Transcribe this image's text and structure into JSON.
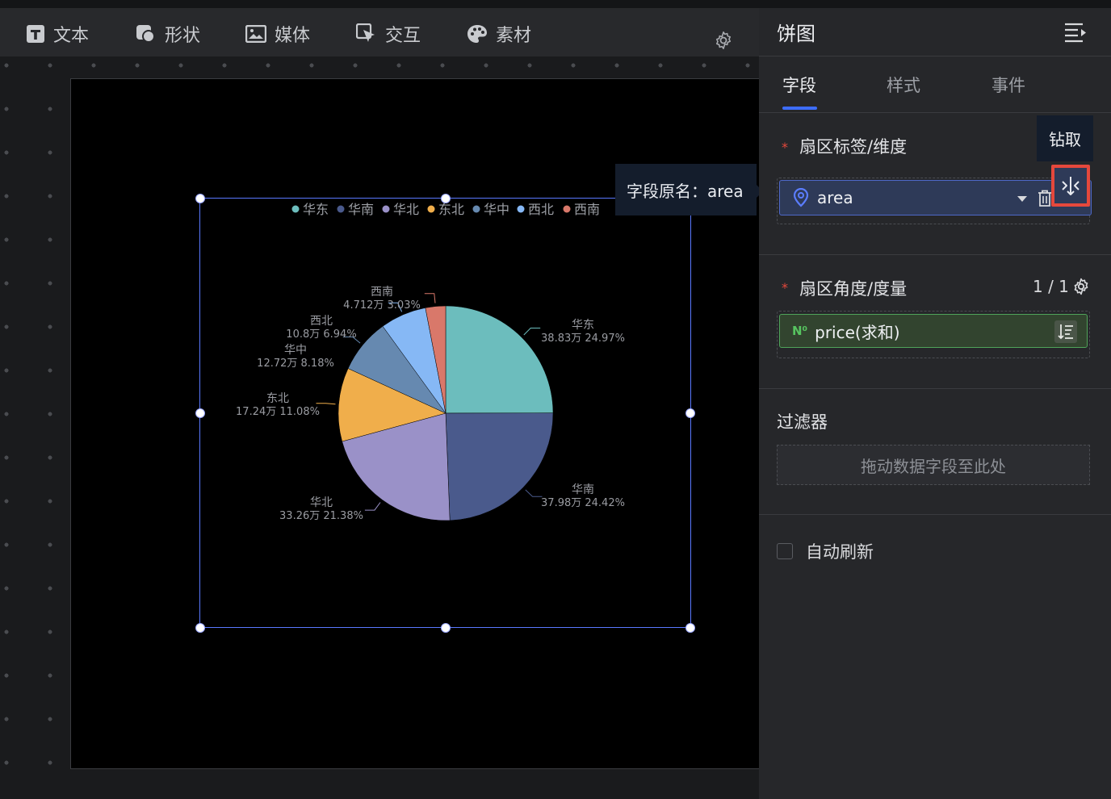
{
  "toolbar": {
    "items": [
      {
        "label": "文本",
        "icon": "text-icon"
      },
      {
        "label": "形状",
        "icon": "shape-icon"
      },
      {
        "label": "媒体",
        "icon": "media-icon"
      },
      {
        "label": "交互",
        "icon": "interaction-icon"
      },
      {
        "label": "素材",
        "icon": "palette-icon"
      }
    ],
    "settings_icon": "gear-icon"
  },
  "tooltip": {
    "text": "字段原名：area"
  },
  "panel": {
    "title": "饼图",
    "menu_icon": "menu-collapse-icon",
    "tabs": [
      {
        "label": "字段",
        "active": true
      },
      {
        "label": "样式",
        "active": false
      },
      {
        "label": "事件",
        "active": false
      }
    ],
    "dimension": {
      "label": "扇区标签/维度",
      "required_mark": "*",
      "field": "area",
      "field_icon": "location-pin-icon",
      "drill_tooltip": "钻取"
    },
    "measure": {
      "label": "扇区角度/度量",
      "required_mark": "*",
      "count": "1 / 1",
      "field": "price(求和)",
      "field_type_badge": "N⁰"
    },
    "filter": {
      "label": "过滤器",
      "placeholder": "拖动数据字段至此处"
    },
    "auto_refresh": {
      "label": "自动刷新",
      "checked": false
    }
  },
  "chart_data": {
    "type": "pie",
    "legend_position": "top",
    "series": [
      {
        "categories": [
          "华东",
          "华南",
          "华北",
          "东北",
          "华中",
          "西北",
          "西南"
        ],
        "values": [
          38.83,
          37.98,
          33.26,
          17.24,
          12.72,
          10.8,
          4.712
        ],
        "value_labels": [
          "38.83万",
          "37.98万",
          "33.26万",
          "17.24万",
          "12.72万",
          "10.8万",
          "4.712万"
        ],
        "percent_labels": [
          "24.97%",
          "24.42%",
          "21.38%",
          "11.08%",
          "8.18%",
          "6.94%",
          "3.03%"
        ],
        "colors": [
          "#6cbdbd",
          "#4a5a8c",
          "#9a91c8",
          "#f0ae4b",
          "#6689b0",
          "#86b8f5",
          "#d9786a"
        ]
      }
    ]
  }
}
